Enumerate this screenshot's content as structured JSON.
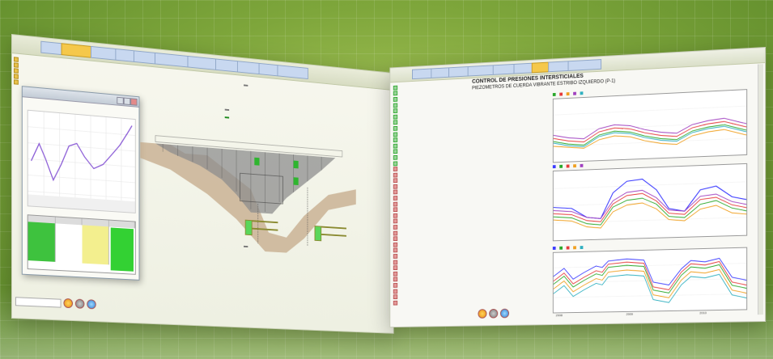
{
  "left_window": {
    "tabs": [
      "",
      "",
      "",
      "",
      "",
      "",
      "",
      "",
      "",
      "",
      "",
      "",
      "",
      ""
    ],
    "active_tab_index": 1,
    "tree_items": [
      "",
      "",
      "",
      "",
      ""
    ],
    "dialog": {
      "title": "",
      "chart_title": "",
      "chart_date": "",
      "table_headers": [
        "",
        "",
        "",
        ""
      ],
      "table_rows": [
        {
          "name": "",
          "value": ""
        },
        {
          "name": "",
          "value": ""
        },
        {
          "name": "",
          "value": ""
        },
        {
          "name": "",
          "value": ""
        }
      ]
    },
    "diagram": {
      "top_label": "",
      "left_label": "",
      "green_label": "",
      "section_label": "",
      "readings_left": [
        "",
        ""
      ],
      "readings_right": [
        "",
        ""
      ],
      "bottom_label": ""
    }
  },
  "right_window": {
    "tabs": [
      "",
      "",
      "",
      "",
      "",
      "",
      "",
      "",
      ""
    ],
    "active_tab_index": 6,
    "title_line1": "CONTROL DE PRESIONES INTERSTICIALES",
    "title_line2": "PIEZOMETROS DE CUERDA VIBRANTE ESTRIBO IZQUIERDO (P-1)",
    "date_top": "",
    "date_bottom": "",
    "badge": "",
    "x_labels": [
      "2008",
      "2009",
      "2010"
    ],
    "series_colors": [
      "#3b3bff",
      "#2aa82a",
      "#e63b3b",
      "#f0a020",
      "#a040c0",
      "#30b0c0"
    ]
  },
  "colors": {
    "background": "#7ea63b",
    "accent_tab": "#f5c84a",
    "status_green": "#33d133",
    "reading_yellow": "#f2f28a"
  }
}
